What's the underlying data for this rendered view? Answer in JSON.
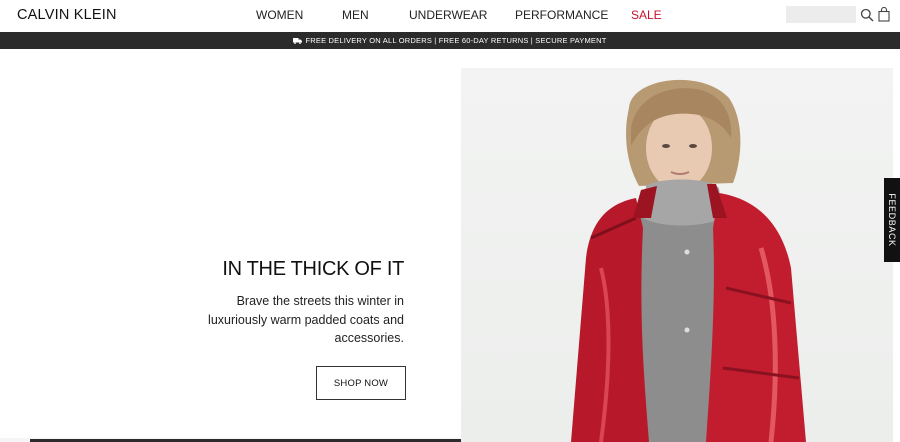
{
  "header": {
    "logo": "CALVIN KLEIN",
    "nav": [
      {
        "label": "WOMEN"
      },
      {
        "label": "MEN"
      },
      {
        "label": "UNDERWEAR"
      },
      {
        "label": "PERFORMANCE"
      },
      {
        "label": "SALE"
      }
    ],
    "search_placeholder": "",
    "icons": {
      "search": "search-icon",
      "bag": "shopping-bag-icon"
    },
    "sale_color": "#c8102e"
  },
  "promo": {
    "text": "FREE DELIVERY ON ALL ORDERS | FREE 60-DAY RETURNS | SECURE PAYMENT",
    "icon": "truck-icon",
    "background": "#2b2b2b"
  },
  "hero": {
    "title": "IN THE THICK OF IT",
    "body": "Brave the streets this winter in luxuriously warm padded coats and accessories.",
    "cta": "SHOP NOW",
    "image_subject": "model-in-red-padded-coat"
  },
  "feedback": {
    "label": "FEEDBACK"
  }
}
